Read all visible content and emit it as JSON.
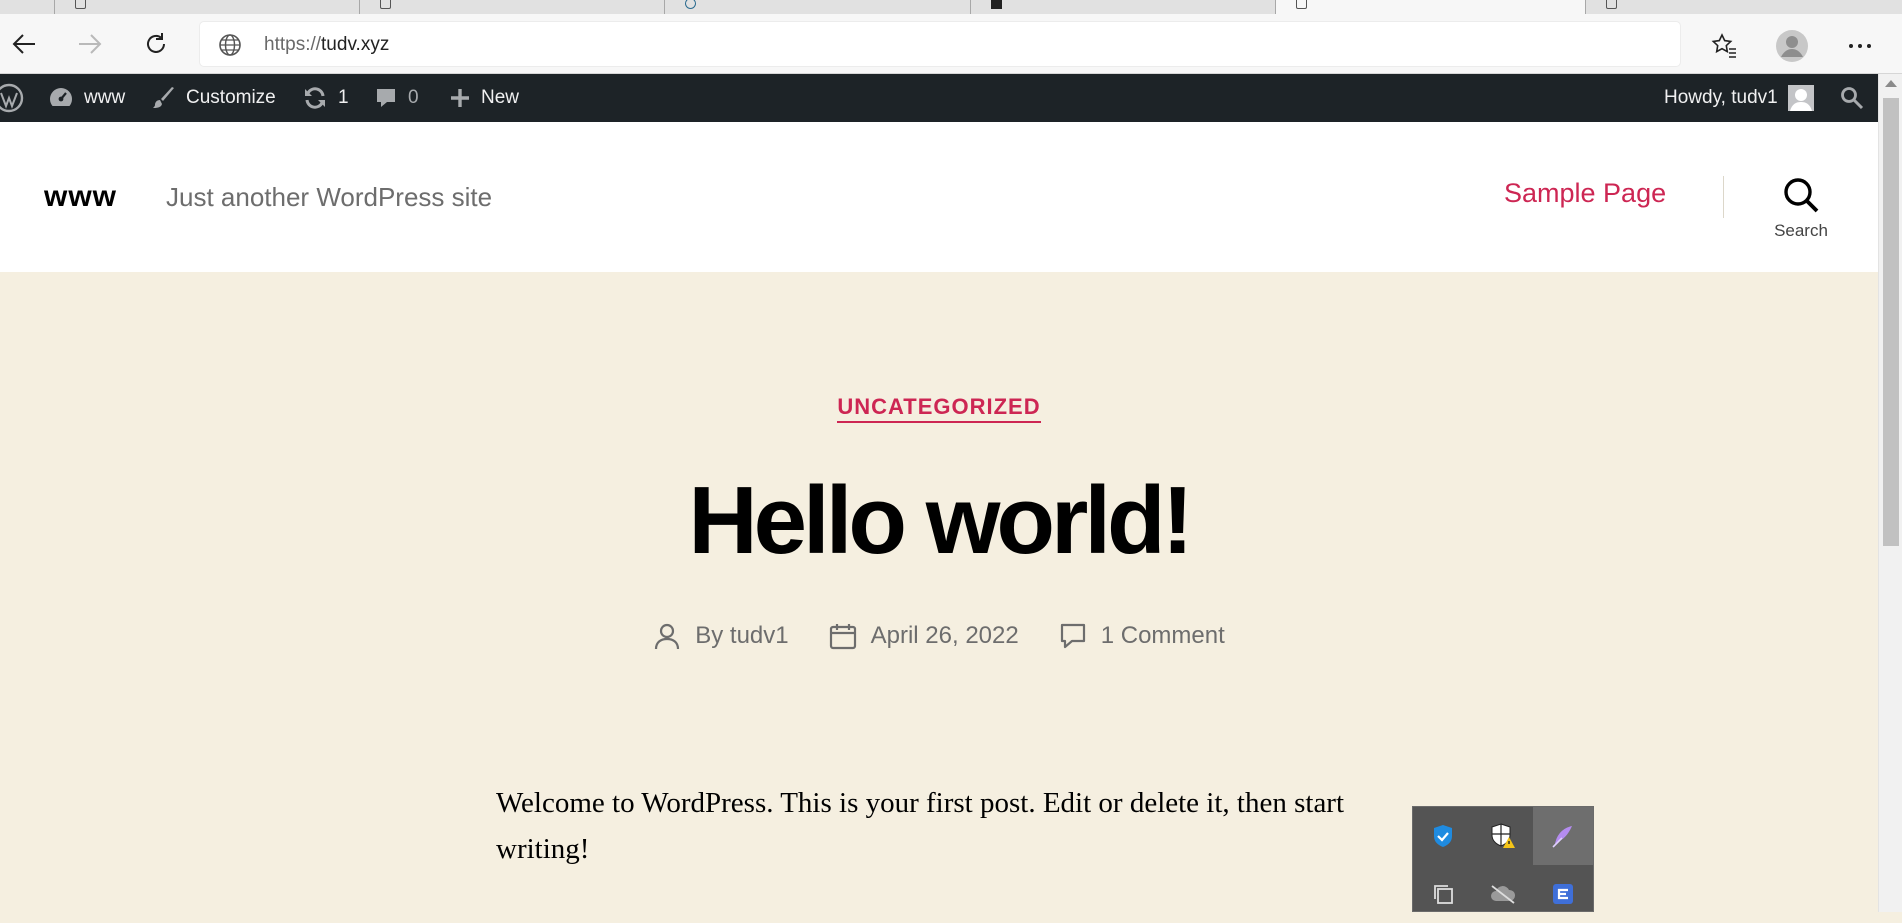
{
  "browser": {
    "address_url_scheme": "https://",
    "address_url_host": "tudv.xyz"
  },
  "admin_bar": {
    "site_name": "www",
    "customize": "Customize",
    "updates_count": "1",
    "comments_count": "0",
    "new_label": "New",
    "howdy": "Howdy, tudv1"
  },
  "site": {
    "title": "www",
    "description": "Just another WordPress site",
    "nav": [
      "Sample Page"
    ],
    "search_label": "Search"
  },
  "post": {
    "category": "UNCATEGORIZED",
    "title": "Hello world!",
    "author": "By tudv1",
    "date": "April 26, 2022",
    "comments": "1 Comment",
    "body": "Welcome to WordPress. This is your first post. Edit or delete it, then start writing!"
  },
  "colors": {
    "accent": "#cd2653",
    "admin_bar_bg": "#1d2327",
    "content_bg": "#f5efe0"
  },
  "tray_icons": [
    "defender-shield-icon",
    "security-warning-icon",
    "feather-pen-icon",
    "copy-icon",
    "cloud-offline-icon",
    "app-e-icon"
  ]
}
